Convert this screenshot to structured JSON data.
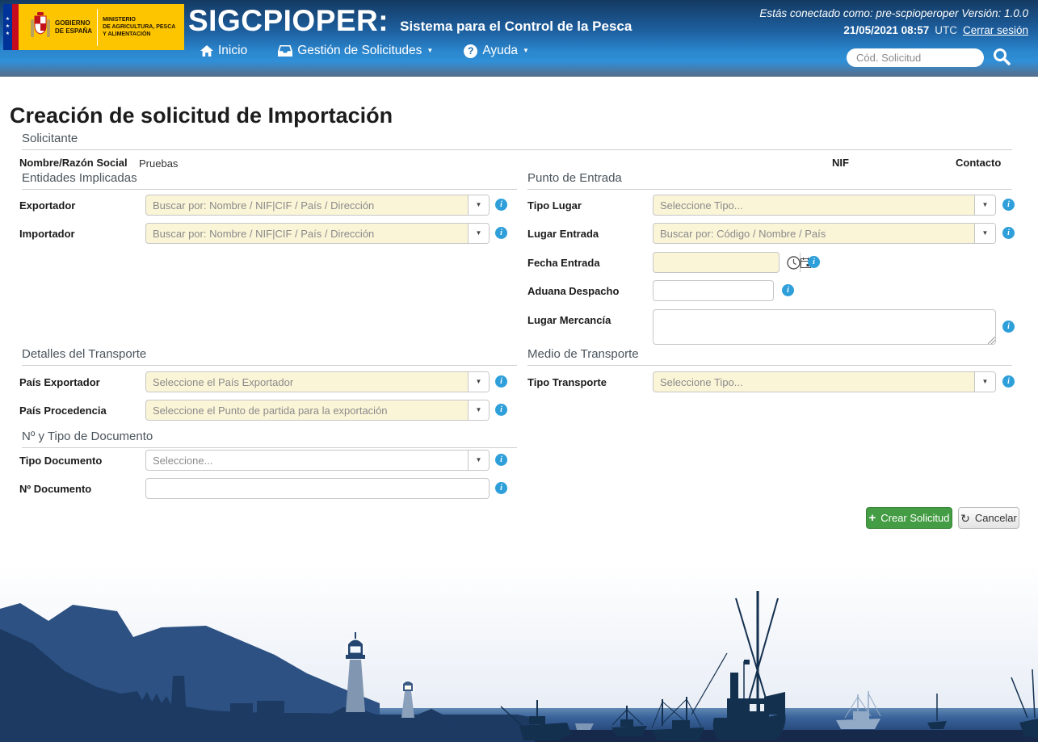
{
  "colors": {
    "header_top": "#143a62",
    "header_bright": "#3090d8",
    "header_band": "#566f8c",
    "logo_yellow": "#fdc500",
    "input_yellow": "#fbf5d8",
    "info_blue": "#2f9fda",
    "success_green": "#449d44",
    "footer_navy": "#1d3a63",
    "sea_blue": "#2a4f80"
  },
  "icons": {
    "caret_down": "▼",
    "question_mark": "?",
    "plus": "+",
    "refresh": "↻",
    "info_i": "i",
    "eu_stars": "★★★"
  },
  "header": {
    "logo": {
      "gobierno_line1": "GOBIERNO",
      "gobierno_line2": "DE ESPAÑA",
      "ministerio_line1": "MINISTERIO",
      "ministerio_line2": "DE AGRICULTURA, PESCA",
      "ministerio_line3": "Y ALIMENTACIÓN"
    },
    "app_title": "SIGCPIOPER:",
    "app_subtitle": "Sistema para el Control de la Pesca",
    "nav": {
      "inicio": "Inicio",
      "gestion": "Gestión de Solicitudes",
      "ayuda": "Ayuda"
    },
    "session_text": "Estás conectado como: pre-scpioperoper Versión: 1.0.0",
    "datetime": "21/05/2021 08:57",
    "utc_label": "UTC",
    "logout_label": "Cerrar sesión",
    "search_placeholder": "Cód. Solicitud"
  },
  "page": {
    "title": "Creación de solicitud de Importación"
  },
  "sections": {
    "solicitante": "Solicitante",
    "entidades": "Entidades Implicadas",
    "punto_entrada": "Punto de Entrada",
    "detalles_transporte": "Detalles del Transporte",
    "medio_transporte": "Medio de Transporte",
    "documento": "Nº y Tipo de Documento"
  },
  "solicitante": {
    "nombre_label": "Nombre/Razón Social",
    "nombre_value": "Pruebas",
    "nif_label": "NIF",
    "contacto_label": "Contacto"
  },
  "fields": {
    "exportador": {
      "label": "Exportador",
      "placeholder": "Buscar por: Nombre / NIF|CIF / País / Dirección"
    },
    "importador": {
      "label": "Importador",
      "placeholder": "Buscar por: Nombre / NIF|CIF / País / Dirección"
    },
    "tipo_lugar": {
      "label": "Tipo Lugar",
      "placeholder": "Seleccione Tipo..."
    },
    "lugar_entrada": {
      "label": "Lugar Entrada",
      "placeholder": "Buscar por: Código / Nombre / País"
    },
    "fecha_entrada": {
      "label": "Fecha Entrada",
      "value": ""
    },
    "aduana_despacho": {
      "label": "Aduana Despacho",
      "value": ""
    },
    "lugar_mercancia": {
      "label": "Lugar Mercancía",
      "value": ""
    },
    "pais_exportador": {
      "label": "País Exportador",
      "placeholder": "Seleccione el País Exportador"
    },
    "pais_procedencia": {
      "label": "País Procedencia",
      "placeholder": "Seleccione el Punto de partida para la exportación"
    },
    "tipo_documento": {
      "label": "Tipo Documento",
      "placeholder": "Seleccione..."
    },
    "num_documento": {
      "label": "Nº Documento",
      "value": ""
    },
    "tipo_transporte": {
      "label": "Tipo Transporte",
      "placeholder": "Seleccione Tipo..."
    }
  },
  "buttons": {
    "crear": "Crear Solicitud",
    "cancelar": "Cancelar"
  }
}
